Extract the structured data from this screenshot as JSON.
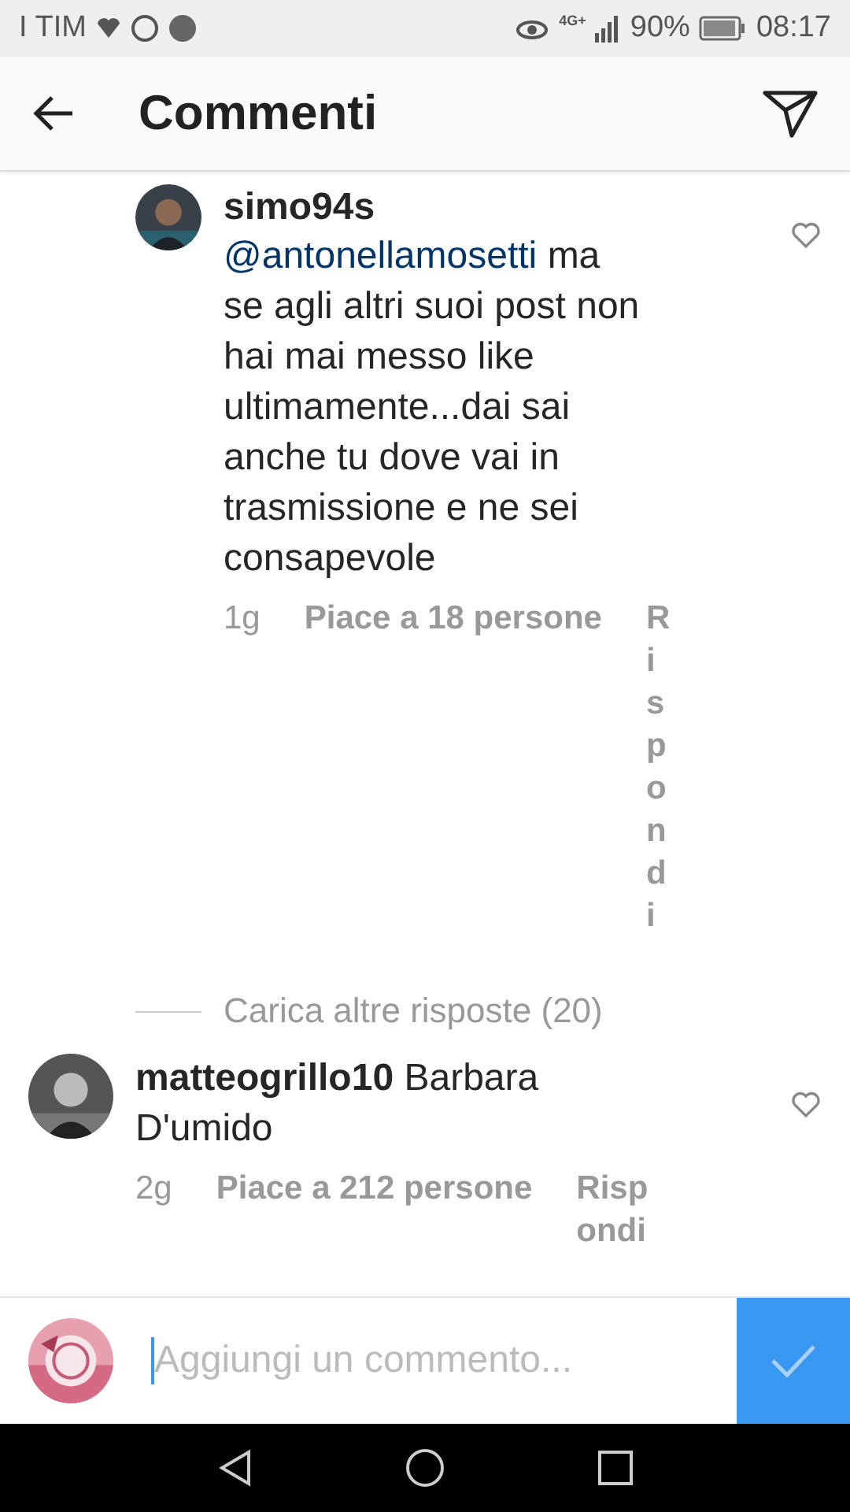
{
  "status_bar": {
    "carrier": "I TIM",
    "network": "4G+",
    "battery": "90%",
    "time": "08:17"
  },
  "header": {
    "title": "Commenti"
  },
  "comments": [
    {
      "kind": "reply",
      "username": "simo94s",
      "mention": "@antonellamosetti",
      "text": "ma se agli altri suoi post non hai mai messo like ultimamente...dai sai anche tu dove vai in trasmissione e ne sei consapevole",
      "time": "1g",
      "likes": "Piace a 18 persone",
      "reply": "Rispondi",
      "liked": false
    },
    {
      "kind": "load_more",
      "label": "Carica altre risposte (20)"
    },
    {
      "kind": "top",
      "username": "matteogrillo10",
      "text": "Barbara D'umido",
      "time": "2g",
      "likes": "Piace a 212 persone",
      "reply": "Rispondi",
      "liked": false
    }
  ],
  "composer": {
    "placeholder": "Aggiungi un commento..."
  }
}
